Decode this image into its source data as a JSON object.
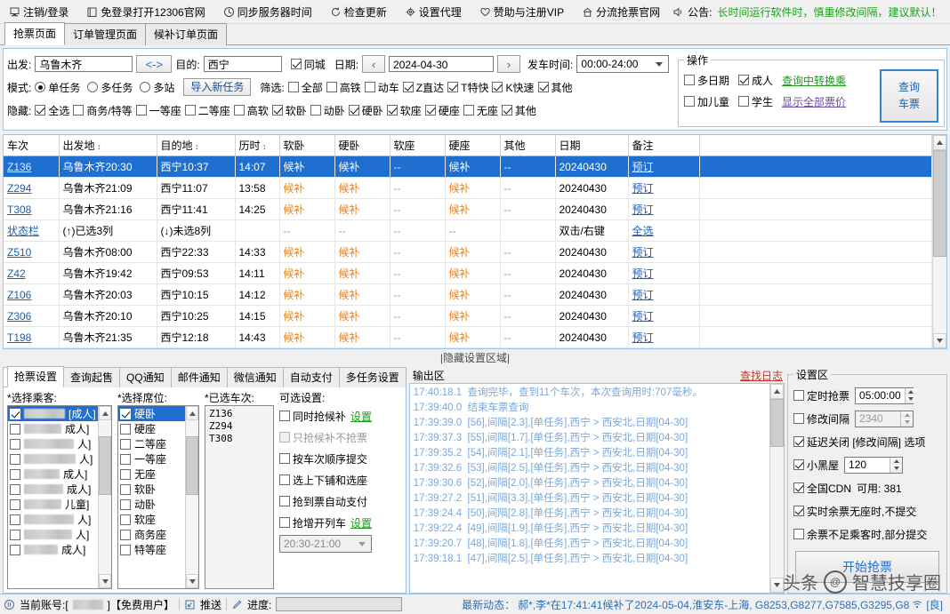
{
  "topbar": {
    "items": [
      {
        "icon": "logout-icon",
        "label": "注销/登录"
      },
      {
        "icon": "book-icon",
        "label": "免登录打开12306官网"
      },
      {
        "icon": "clock-icon",
        "label": "同步服务器时间"
      },
      {
        "icon": "refresh-icon",
        "label": "检查更新"
      },
      {
        "icon": "gear-icon",
        "label": "设置代理"
      },
      {
        "icon": "heart-icon",
        "label": "赞助与注册VIP"
      },
      {
        "icon": "home-icon",
        "label": "分流抢票官网"
      },
      {
        "icon": "speaker-icon",
        "label": "公告:"
      }
    ],
    "notice": "长时间运行软件时，慎重修改间隔，建议默认！",
    "notice_color": "#19a319"
  },
  "page_tabs": [
    {
      "label": "抢票页面",
      "active": true
    },
    {
      "label": "订单管理页面",
      "active": false
    },
    {
      "label": "候补订单页面",
      "active": false
    }
  ],
  "query": {
    "from_label": "出发:",
    "from_value": "乌鲁木齐",
    "swap_label": "<->",
    "to_label": "目的:",
    "to_value": "西宁",
    "same_city_label": "同城",
    "same_city_checked": true,
    "date_label": "日期:",
    "date_prev": "‹",
    "date_value": "2024-04-30",
    "date_next": "›",
    "depart_time_label": "发车时间:",
    "depart_time_value": "00:00-24:00",
    "mode_label": "模式:",
    "modes": [
      {
        "label": "单任务",
        "checked": true
      },
      {
        "label": "多任务",
        "checked": false
      },
      {
        "label": "多站",
        "checked": false
      }
    ],
    "import_button": "导入新任务",
    "filter_label": "筛选:",
    "filters": [
      {
        "label": "全部",
        "checked": false
      },
      {
        "label": "高铁",
        "checked": false
      },
      {
        "label": "动车",
        "checked": false
      },
      {
        "label": "Z直达",
        "checked": true
      },
      {
        "label": "T特快",
        "checked": true
      },
      {
        "label": "K快速",
        "checked": true
      },
      {
        "label": "其他",
        "checked": true
      }
    ],
    "hide_label": "隐藏:",
    "hides": [
      {
        "label": "全选",
        "checked": true
      },
      {
        "label": "商务/特等",
        "checked": false
      },
      {
        "label": "一等座",
        "checked": false
      },
      {
        "label": "二等座",
        "checked": false
      },
      {
        "label": "高软",
        "checked": false
      },
      {
        "label": "软卧",
        "checked": true
      },
      {
        "label": "动卧",
        "checked": false
      },
      {
        "label": "硬卧",
        "checked": true
      },
      {
        "label": "软座",
        "checked": true
      },
      {
        "label": "硬座",
        "checked": true
      },
      {
        "label": "无座",
        "checked": false
      },
      {
        "label": "其他",
        "checked": true
      }
    ]
  },
  "operation": {
    "title": "操作",
    "checks": [
      {
        "label": "多日期",
        "checked": false
      },
      {
        "label": "成人",
        "checked": true
      },
      {
        "label": "加儿童",
        "checked": false
      },
      {
        "label": "学生",
        "checked": false
      }
    ],
    "link_transfer": "查询中转换乘",
    "link_allprice": "显示全部票价",
    "query_button_line1": "查询",
    "query_button_line2": "车票"
  },
  "table": {
    "headers": [
      "车次",
      "出发地",
      "目的地",
      "历时",
      "软卧",
      "硬卧",
      "软座",
      "硬座",
      "其他",
      "日期",
      "备注"
    ],
    "sortable": [
      false,
      true,
      true,
      true,
      false,
      false,
      false,
      false,
      false,
      false,
      false
    ],
    "rows": [
      {
        "selected": true,
        "train": "Z136",
        "from": "乌鲁木齐20:30",
        "to": "西宁10:37",
        "dur": "14:07",
        "rw": "候补",
        "yw": "候补",
        "rz": "--",
        "yz": "候补",
        "other": "--",
        "date": "20240430",
        "note": "预订"
      },
      {
        "selected": false,
        "train": "Z294",
        "from": "乌鲁木齐21:09",
        "to": "西宁11:07",
        "dur": "13:58",
        "rw": "候补",
        "yw": "候补",
        "rz": "--",
        "yz": "候补",
        "other": "--",
        "date": "20240430",
        "note": "预订"
      },
      {
        "selected": false,
        "train": "T308",
        "from": "乌鲁木齐21:16",
        "to": "西宁11:41",
        "dur": "14:25",
        "rw": "候补",
        "yw": "候补",
        "rz": "--",
        "yz": "候补",
        "other": "--",
        "date": "20240430",
        "note": "预订"
      }
    ],
    "status_row": {
      "train": "状态栏",
      "from": "(↑)已选3列",
      "to": "(↓)未选8列",
      "dur": "",
      "rw": "--",
      "yw": "--",
      "rz": "--",
      "yz": "--",
      "other": "",
      "date": "双击/右键",
      "note": "全选"
    },
    "rows2": [
      {
        "selected": false,
        "train": "Z510",
        "from": "乌鲁木齐08:00",
        "to": "西宁22:33",
        "dur": "14:33",
        "rw": "候补",
        "yw": "候补",
        "rz": "--",
        "yz": "候补",
        "other": "--",
        "date": "20240430",
        "note": "预订"
      },
      {
        "selected": false,
        "train": "Z42",
        "from": "乌鲁木齐19:42",
        "to": "西宁09:53",
        "dur": "14:11",
        "rw": "候补",
        "yw": "候补",
        "rz": "--",
        "yz": "候补",
        "other": "--",
        "date": "20240430",
        "note": "预订"
      },
      {
        "selected": false,
        "train": "Z106",
        "from": "乌鲁木齐20:03",
        "to": "西宁10:15",
        "dur": "14:12",
        "rw": "候补",
        "yw": "候补",
        "rz": "--",
        "yz": "候补",
        "other": "--",
        "date": "20240430",
        "note": "预订"
      },
      {
        "selected": false,
        "train": "Z306",
        "from": "乌鲁木齐20:10",
        "to": "西宁10:25",
        "dur": "14:15",
        "rw": "候补",
        "yw": "候补",
        "rz": "--",
        "yz": "候补",
        "other": "--",
        "date": "20240430",
        "note": "预订"
      },
      {
        "selected": false,
        "train": "T198",
        "from": "乌鲁木齐21:35",
        "to": "西宁12:18",
        "dur": "14:43",
        "rw": "候补",
        "yw": "候补",
        "rz": "--",
        "yz": "候补",
        "other": "--",
        "date": "20240430",
        "note": "预订"
      }
    ]
  },
  "hide_strip": "|隐藏设置区域|",
  "settings_tabs": [
    {
      "label": "抢票设置",
      "active": true
    },
    {
      "label": "查询起售",
      "active": false
    },
    {
      "label": "QQ通知",
      "active": false
    },
    {
      "label": "邮件通知",
      "active": false
    },
    {
      "label": "微信通知",
      "active": false
    },
    {
      "label": "自动支付",
      "active": false
    },
    {
      "label": "多任务设置",
      "active": false
    }
  ],
  "passengers": {
    "title": "*选择乘客:",
    "items": [
      {
        "label": "[成人]",
        "checked": true,
        "highlight": true,
        "blur": 78
      },
      {
        "label": "成人]",
        "checked": false,
        "highlight": false,
        "blur": 66
      },
      {
        "label": "人]",
        "checked": false,
        "highlight": false,
        "blur": 80
      },
      {
        "label": "人]",
        "checked": false,
        "highlight": false,
        "blur": 82
      },
      {
        "label": "成人]",
        "checked": false,
        "highlight": false,
        "blur": 60
      },
      {
        "label": "成人]",
        "checked": false,
        "highlight": false,
        "blur": 64
      },
      {
        "label": "儿童]",
        "checked": false,
        "highlight": false,
        "blur": 62
      },
      {
        "label": "人]",
        "checked": false,
        "highlight": false,
        "blur": 80
      },
      {
        "label": "人]",
        "checked": false,
        "highlight": false,
        "blur": 78
      },
      {
        "label": "成人]",
        "checked": false,
        "highlight": false,
        "blur": 56
      }
    ]
  },
  "seats": {
    "title": "*选择席位:",
    "items": [
      {
        "label": "硬卧",
        "checked": true,
        "highlight": true
      },
      {
        "label": "硬座",
        "checked": false,
        "highlight": false
      },
      {
        "label": "二等座",
        "checked": false,
        "highlight": false
      },
      {
        "label": "一等座",
        "checked": false,
        "highlight": false
      },
      {
        "label": "无座",
        "checked": false,
        "highlight": false
      },
      {
        "label": "软卧",
        "checked": false,
        "highlight": false
      },
      {
        "label": "动卧",
        "checked": false,
        "highlight": false
      },
      {
        "label": "软座",
        "checked": false,
        "highlight": false
      },
      {
        "label": "商务座",
        "checked": false,
        "highlight": false
      },
      {
        "label": "特等座",
        "checked": false,
        "highlight": false
      }
    ]
  },
  "selected_trains": {
    "title": "*已选车次:",
    "items": [
      "Z136",
      "Z294",
      "T308"
    ]
  },
  "optional": {
    "title": "可选设置:",
    "items": [
      {
        "label": "同时抢候补",
        "checked": false,
        "link": "设置",
        "dim": false
      },
      {
        "label": "只抢候补不抢票",
        "checked": false,
        "link": "",
        "dim": true
      },
      {
        "label": "按车次顺序提交",
        "checked": false,
        "link": "",
        "dim": false
      },
      {
        "label": "选上下铺和选座",
        "checked": false,
        "link": "",
        "dim": false
      },
      {
        "label": "抢到票自动支付",
        "checked": false,
        "link": "",
        "dim": false
      },
      {
        "label": "抢增开列车",
        "checked": false,
        "link": "设置",
        "dim": false
      }
    ],
    "time_select_value": "20:30-21:00"
  },
  "output": {
    "title": "输出区",
    "find_log_link": "查找日志",
    "lines": [
      {
        "ts": "17:40:18.1",
        "text": "查询完毕，查到11个车次，本次查询用时:707毫秒。"
      },
      {
        "ts": "17:39:40.0",
        "text": "结束车票查询"
      },
      {
        "ts": "17:39:39.0",
        "text": "[56],间隔[2.3],[单任务],西宁 > 西安北,日期[04-30]"
      },
      {
        "ts": "17:39:37.3",
        "text": "[55],间隔[1.7],[单任务],西宁 > 西安北,日期[04-30]"
      },
      {
        "ts": "17:39:35.2",
        "text": "[54],间隔[2.1],[单任务],西宁 > 西安北,日期[04-30]"
      },
      {
        "ts": "17:39:32.6",
        "text": "[53],间隔[2.5],[单任务],西宁 > 西安北,日期[04-30]"
      },
      {
        "ts": "17:39:30.6",
        "text": "[52],间隔[2.0],[单任务],西宁 > 西安北,日期[04-30]"
      },
      {
        "ts": "17:39:27.2",
        "text": "[51],间隔[3.3],[单任务],西宁 > 西安北,日期[04-30]"
      },
      {
        "ts": "17:39:24.4",
        "text": "[50],间隔[2.8],[单任务],西宁 > 西安北,日期[04-30]"
      },
      {
        "ts": "17:39:22.4",
        "text": "[49],间隔[1.9],[单任务],西宁 > 西安北,日期[04-30]"
      },
      {
        "ts": "17:39:20.7",
        "text": "[48],间隔[1.8],[单任务],西宁 > 西安北,日期[04-30]"
      },
      {
        "ts": "17:39:18.1",
        "text": "[47],间隔[2.5],[单任务],西宁 > 西安北,日期[04-30]"
      }
    ]
  },
  "settings_area": {
    "title": "设置区",
    "rows": [
      {
        "label": "定时抢票",
        "checked": false,
        "value": "05:00:00",
        "spinner": true,
        "dim": false
      },
      {
        "label": "修改间隔",
        "checked": false,
        "value": "2340",
        "spinner": true,
        "dim": true
      },
      {
        "label": "延迟关闭 [修改间隔] 选项",
        "checked": true,
        "value": "",
        "spinner": false,
        "dim": false
      },
      {
        "label": "小黑屋",
        "checked": true,
        "value": "120",
        "spinner": true,
        "dim": false
      },
      {
        "label": "全国CDN",
        "checked": true,
        "value": "",
        "spinner": false,
        "dim": false,
        "suffix": "可用: 381"
      },
      {
        "label": "实时余票无座时,不提交",
        "checked": true,
        "value": "",
        "spinner": false,
        "dim": false
      },
      {
        "label": "余票不足乘客时,部分提交",
        "checked": false,
        "value": "",
        "spinner": false,
        "dim": false
      }
    ],
    "start_button": "开始抢票"
  },
  "statusbar": {
    "account_prefix": "当前账号:[",
    "account_suffix": "]【免费用户】",
    "push_label": "推送",
    "progress_label": "进度:",
    "latest_label": "最新动态：",
    "latest_text": "郝*,李*在17:41:41候补了2024-05-04,淮安东-上海, G8253,G8277,G7585,G3295,G8",
    "latest_tail": "[良]"
  },
  "watermark": {
    "prefix": "头条",
    "text": "智慧技享圈"
  }
}
